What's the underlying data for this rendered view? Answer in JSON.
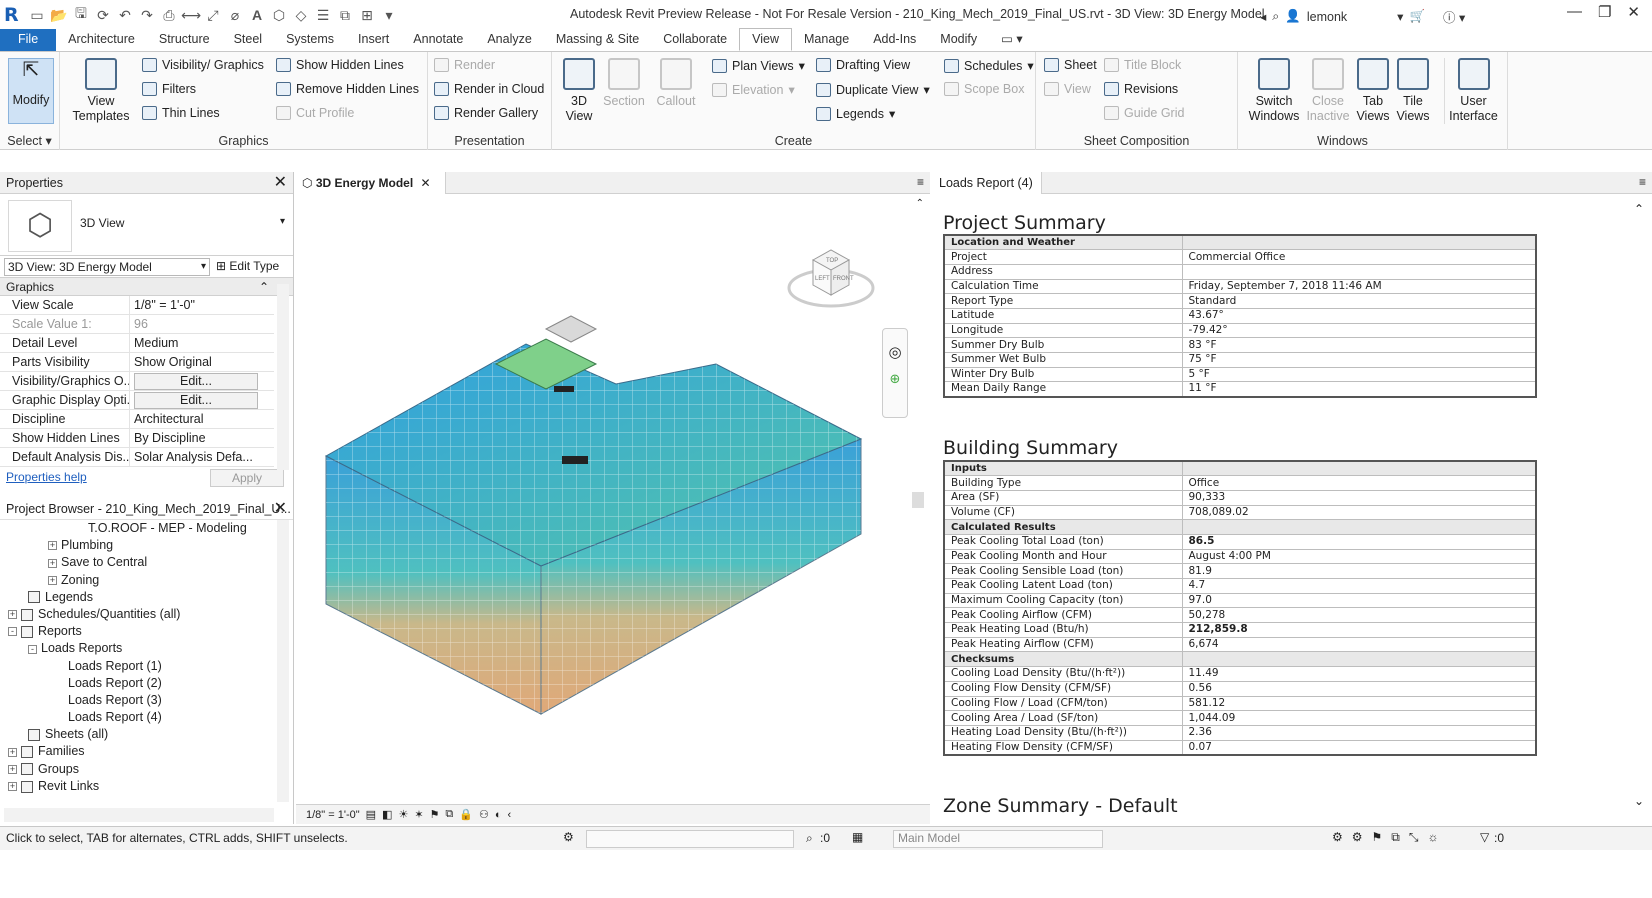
{
  "window": {
    "title": "Autodesk Revit Preview Release - Not For Resale Version - 210_King_Mech_2019_Final_US.rvt - 3D View: 3D Energy Model",
    "user": "lemonk"
  },
  "tabs": [
    "File",
    "Architecture",
    "Structure",
    "Steel",
    "Systems",
    "Insert",
    "Annotate",
    "Analyze",
    "Massing & Site",
    "Collaborate",
    "View",
    "Manage",
    "Add-Ins",
    "Modify"
  ],
  "ribbon": {
    "select": {
      "modify": "Modify",
      "label": "Select"
    },
    "graphics": {
      "view_templates": "View Templates",
      "visibility": "Visibility/ Graphics",
      "filters": "Filters",
      "thin_lines": "Thin Lines",
      "show_hidden": "Show Hidden Lines",
      "remove_hidden": "Remove Hidden Lines",
      "cut_profile": "Cut Profile",
      "label": "Graphics"
    },
    "presentation": {
      "render": "Render",
      "render_cloud": "Render in Cloud",
      "render_gallery": "Render Gallery",
      "label": "Presentation"
    },
    "create": {
      "view3d": "3D View",
      "section": "Section",
      "callout": "Callout",
      "plan_views": "Plan Views",
      "elevation": "Elevation",
      "drafting_view": "Drafting View",
      "duplicate_view": "Duplicate View",
      "legends": "Legends",
      "schedules": "Schedules",
      "scope_box": "Scope Box",
      "label": "Create"
    },
    "sheet": {
      "sheet": "Sheet",
      "view": "View",
      "title_block": "Title Block",
      "revisions": "Revisions",
      "guide_grid": "Guide Grid",
      "label": "Sheet Composition"
    },
    "windows": {
      "switch": "Switch Windows",
      "close_inactive": "Close Inactive",
      "tab_views": "Tab Views",
      "tile_views": "Tile Views",
      "user_interface": "User Interface",
      "label": "Windows"
    }
  },
  "properties": {
    "title": "Properties",
    "type_name": "3D View",
    "view_selector": "3D View: 3D Energy Model",
    "edit_type": "Edit Type",
    "group": "Graphics",
    "rows": [
      {
        "k": "View Scale",
        "v": "1/8\" = 1'-0\""
      },
      {
        "k": "Scale Value    1:",
        "v": "96"
      },
      {
        "k": "Detail Level",
        "v": "Medium"
      },
      {
        "k": "Parts Visibility",
        "v": "Show Original"
      },
      {
        "k": "Visibility/Graphics O...",
        "v": "Edit..."
      },
      {
        "k": "Graphic Display Opti...",
        "v": "Edit..."
      },
      {
        "k": "Discipline",
        "v": "Architectural"
      },
      {
        "k": "Show Hidden Lines",
        "v": "By Discipline"
      },
      {
        "k": "Default Analysis Dis...",
        "v": "Solar Analysis Defa..."
      }
    ],
    "help": "Properties help",
    "apply": "Apply"
  },
  "browser": {
    "title": "Project Browser - 210_King_Mech_2019_Final_U...",
    "items": [
      {
        "t": "T.O.ROOF -  MEP - Modeling",
        "lvl": 4,
        "pm": ""
      },
      {
        "t": "Plumbing",
        "lvl": 2,
        "pm": "+"
      },
      {
        "t": "Save to Central",
        "lvl": 2,
        "pm": "+"
      },
      {
        "t": "Zoning",
        "lvl": 2,
        "pm": "+"
      },
      {
        "t": "Legends",
        "lvl": 1,
        "pm": "",
        "ico": true
      },
      {
        "t": "Schedules/Quantities (all)",
        "lvl": 0,
        "pm": "+",
        "ico": true
      },
      {
        "t": "Reports",
        "lvl": 0,
        "pm": "-",
        "ico": true
      },
      {
        "t": "Loads Reports",
        "lvl": 1,
        "pm": "-"
      },
      {
        "t": "Loads Report (1)",
        "lvl": 3,
        "pm": ""
      },
      {
        "t": "Loads Report (2)",
        "lvl": 3,
        "pm": ""
      },
      {
        "t": "Loads Report (3)",
        "lvl": 3,
        "pm": ""
      },
      {
        "t": "Loads Report (4)",
        "lvl": 3,
        "pm": ""
      },
      {
        "t": "Sheets (all)",
        "lvl": 1,
        "pm": "",
        "ico": true
      },
      {
        "t": "Families",
        "lvl": 0,
        "pm": "+",
        "ico": true
      },
      {
        "t": "Groups",
        "lvl": 0,
        "pm": "+",
        "ico": true
      },
      {
        "t": "Revit Links",
        "lvl": 0,
        "pm": "+",
        "ico": true
      }
    ]
  },
  "view": {
    "tab": "3D Energy Model",
    "scale": "1/8\" = 1'-0\"",
    "cube_top": "TOP",
    "cube_left": "LEFT",
    "cube_front": "FRONT"
  },
  "report": {
    "tab": "Loads Report (4)",
    "project_summary": "Project Summary",
    "ps_rows": [
      {
        "k": "Location and Weather",
        "v": "",
        "sec": true
      },
      {
        "k": "Project",
        "v": "Commercial Office"
      },
      {
        "k": "Address",
        "v": ""
      },
      {
        "k": "Calculation Time",
        "v": "Friday, September 7, 2018 11:46 AM"
      },
      {
        "k": "Report Type",
        "v": "Standard"
      },
      {
        "k": "Latitude",
        "v": "43.67°"
      },
      {
        "k": "Longitude",
        "v": "-79.42°"
      },
      {
        "k": "Summer Dry Bulb",
        "v": "83 °F"
      },
      {
        "k": "Summer Wet Bulb",
        "v": "75 °F"
      },
      {
        "k": "Winter Dry Bulb",
        "v": "5 °F"
      },
      {
        "k": "Mean Daily Range",
        "v": "11 °F"
      }
    ],
    "building_summary": "Building Summary",
    "bs_rows": [
      {
        "k": "Inputs",
        "v": "",
        "sec": true
      },
      {
        "k": "Building Type",
        "v": "Office"
      },
      {
        "k": "Area (SF)",
        "v": "90,333"
      },
      {
        "k": "Volume (CF)",
        "v": "708,089.02"
      },
      {
        "k": "Calculated Results",
        "v": "",
        "sec": true
      },
      {
        "k": "Peak Cooling Total Load (ton)",
        "v": "86.5",
        "b": true
      },
      {
        "k": "Peak Cooling Month and Hour",
        "v": "August 4:00 PM"
      },
      {
        "k": "Peak Cooling Sensible Load (ton)",
        "v": "81.9"
      },
      {
        "k": "Peak Cooling Latent Load (ton)",
        "v": "4.7"
      },
      {
        "k": "Maximum Cooling Capacity (ton)",
        "v": "97.0"
      },
      {
        "k": "Peak Cooling Airflow (CFM)",
        "v": "50,278"
      },
      {
        "k": "Peak Heating Load (Btu/h)",
        "v": "212,859.8",
        "b": true
      },
      {
        "k": "Peak Heating Airflow (CFM)",
        "v": "6,674"
      },
      {
        "k": "Checksums",
        "v": "",
        "sec": true
      },
      {
        "k": "Cooling Load Density (Btu/(h·ft²))",
        "v": "11.49"
      },
      {
        "k": "Cooling Flow Density (CFM/SF)",
        "v": "0.56"
      },
      {
        "k": "Cooling Flow / Load (CFM/ton)",
        "v": "581.12"
      },
      {
        "k": "Cooling Area / Load (SF/ton)",
        "v": "1,044.09"
      },
      {
        "k": "Heating Load Density (Btu/(h·ft²))",
        "v": "2.36"
      },
      {
        "k": "Heating Flow Density (CFM/SF)",
        "v": "0.07"
      }
    ],
    "zone_summary": "Zone Summary - Default"
  },
  "status": {
    "hint": "Click to select, TAB for alternates, CTRL adds, SHIFT unselects.",
    "count1": ":0",
    "model": "Main Model",
    "filter_count": ":0"
  }
}
